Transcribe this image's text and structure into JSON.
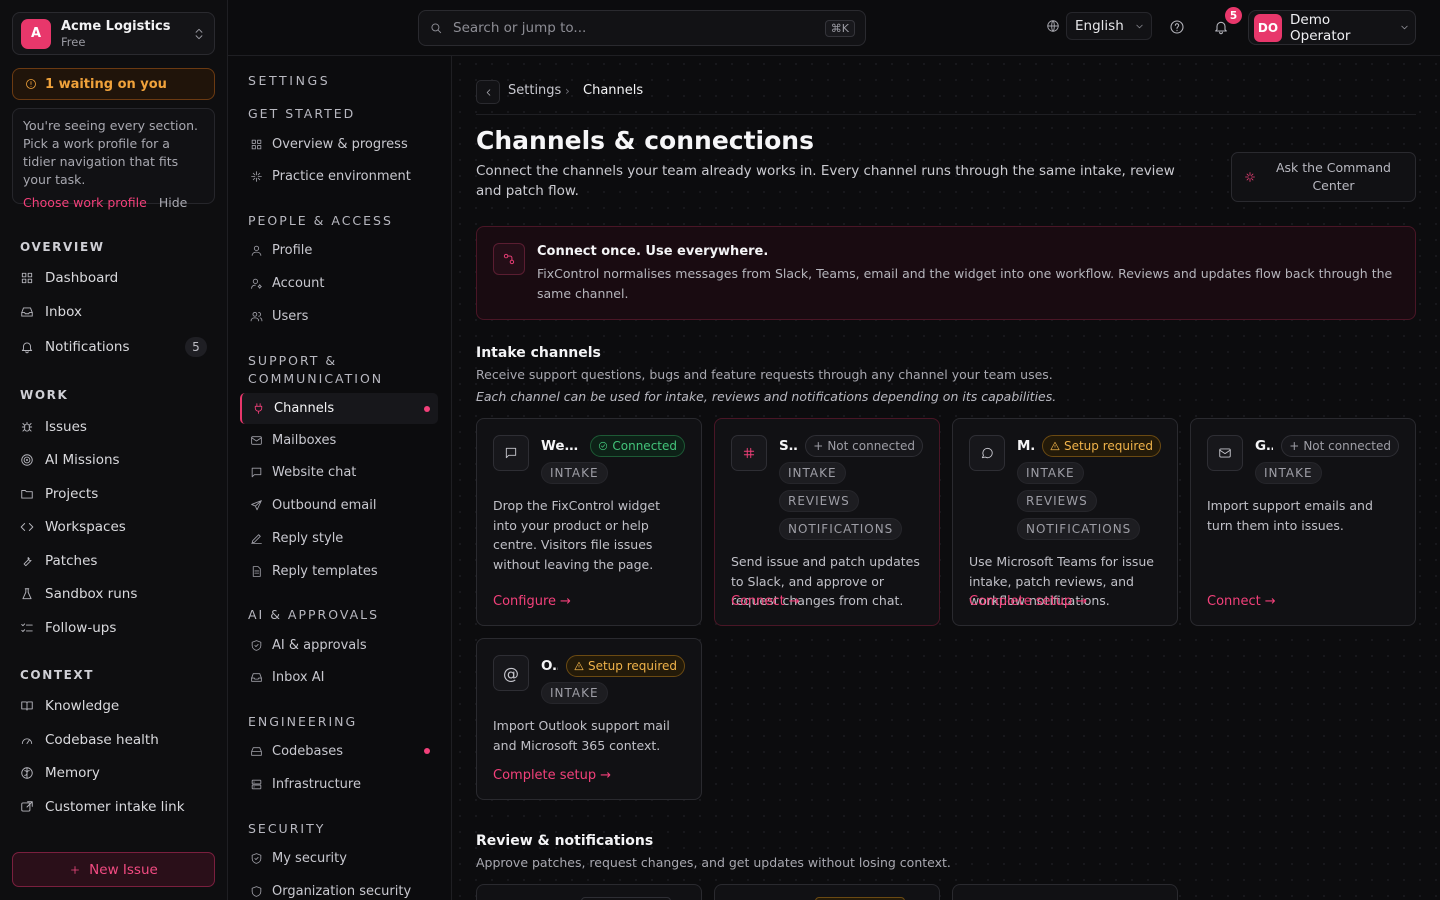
{
  "org": {
    "initial": "A",
    "name": "Acme Logistics",
    "plan": "Free"
  },
  "waiting": {
    "label": "1 waiting on you"
  },
  "profile_hint": {
    "text": "You're seeing every section. Pick a work profile for a tidier navigation that fits your task.",
    "choose_label": "Choose work profile",
    "hide_label": "Hide"
  },
  "nav": {
    "overview_title": "OVERVIEW",
    "work_title": "WORK",
    "context_title": "CONTEXT",
    "overview": [
      {
        "label": "Dashboard",
        "icon": "grid-icon"
      },
      {
        "label": "Inbox",
        "icon": "inbox-icon"
      },
      {
        "label": "Notifications",
        "icon": "bell-icon",
        "count": "5"
      }
    ],
    "work": [
      {
        "label": "Issues",
        "icon": "bug-icon"
      },
      {
        "label": "AI Missions",
        "icon": "target-icon"
      },
      {
        "label": "Projects",
        "icon": "folder-icon"
      },
      {
        "label": "Workspaces",
        "icon": "code-icon"
      },
      {
        "label": "Patches",
        "icon": "wrench-icon"
      },
      {
        "label": "Sandbox runs",
        "icon": "flask-icon"
      },
      {
        "label": "Follow-ups",
        "icon": "list-check-icon"
      }
    ],
    "context": [
      {
        "label": "Knowledge",
        "icon": "book-icon"
      },
      {
        "label": "Codebase health",
        "icon": "gauge-icon"
      },
      {
        "label": "Memory",
        "icon": "brain-icon"
      },
      {
        "label": "Customer intake link",
        "icon": "share-icon"
      }
    ],
    "new_issue_label": "New Issue"
  },
  "topbar": {
    "search_placeholder": "Search or jump to...",
    "search_shortcut": "⌘K",
    "language": "English",
    "notification_count": "5",
    "user_initials": "DO",
    "user_name": "Demo Operator"
  },
  "settings_nav": {
    "title": "SETTINGS",
    "groups": [
      {
        "title": "GET STARTED",
        "items": [
          {
            "label": "Overview & progress",
            "icon": "grid-icon"
          },
          {
            "label": "Practice environment",
            "icon": "sparkle-icon"
          }
        ]
      },
      {
        "title": "PEOPLE & ACCESS",
        "items": [
          {
            "label": "Profile",
            "icon": "user-icon"
          },
          {
            "label": "Account",
            "icon": "user-cog-icon"
          },
          {
            "label": "Users",
            "icon": "users-icon"
          }
        ]
      },
      {
        "title": "SUPPORT & COMMUNICATION",
        "items": [
          {
            "label": "Channels",
            "icon": "plug-icon"
          },
          {
            "label": "Mailboxes",
            "icon": "mail-icon"
          },
          {
            "label": "Website chat",
            "icon": "message-icon"
          },
          {
            "label": "Outbound email",
            "icon": "send-icon"
          },
          {
            "label": "Reply style",
            "icon": "pen-icon"
          },
          {
            "label": "Reply templates",
            "icon": "file-text-icon"
          }
        ]
      },
      {
        "title": "AI & APPROVALS",
        "items": [
          {
            "label": "AI & approvals",
            "icon": "shield-check-icon"
          },
          {
            "label": "Inbox AI",
            "icon": "inbox-icon"
          }
        ]
      },
      {
        "title": "ENGINEERING",
        "items": [
          {
            "label": "Codebases",
            "icon": "database-icon"
          },
          {
            "label": "Infrastructure",
            "icon": "server-icon"
          }
        ]
      },
      {
        "title": "SECURITY",
        "items": [
          {
            "label": "My security",
            "icon": "shield-check-icon"
          },
          {
            "label": "Organization security",
            "icon": "shield-icon"
          }
        ]
      }
    ]
  },
  "breadcrumb": {
    "parent": "Settings",
    "current": "Channels"
  },
  "page": {
    "title": "Channels & connections",
    "description": "Connect the channels your team already works in. Every channel runs through the same intake, review and patch flow.",
    "command_center_label": "Ask the Command Center"
  },
  "banner": {
    "title": "Connect once. Use everywhere.",
    "body": "FixControl normalises messages from Slack, Teams, email and the widget into one workflow. Reviews and updates flow back through the same channel."
  },
  "intake": {
    "title": "Intake channels",
    "subtitle": "Receive support questions, bugs and feature requests through any channel your team uses.",
    "note": "Each channel can be used for intake, reviews and notifications depending on its capabilities.",
    "cards": [
      {
        "name": "Web...",
        "icon": "message-icon",
        "status": "Connected",
        "status_type": "connected",
        "tags": [
          "INTAKE"
        ],
        "description": "Drop the FixControl widget into your product or help centre. Visitors file issues without leaving the page.",
        "action": "Configure"
      },
      {
        "name": "S...",
        "icon": "slack-icon",
        "status": "Not connected",
        "status_type": "notconn",
        "tags": [
          "INTAKE",
          "REVIEWS",
          "NOTIFICATIONS"
        ],
        "description": "Send issue and patch updates to Slack, and approve or request changes from chat.",
        "action": "Connect"
      },
      {
        "name": "M...",
        "icon": "chat-bubble-icon",
        "status": "Setup required",
        "status_type": "setup",
        "tags": [
          "INTAKE",
          "REVIEWS",
          "NOTIFICATIONS"
        ],
        "description": "Use Microsoft Teams for issue intake, patch reviews, and workflow notifications.",
        "action": "Complete setup"
      },
      {
        "name": "G...",
        "icon": "mail-icon",
        "status": "Not connected",
        "status_type": "notconn",
        "tags": [
          "INTAKE"
        ],
        "description": "Import support emails and turn them into issues.",
        "action": "Connect"
      },
      {
        "name": "O...",
        "icon": "at-icon",
        "status": "Setup required",
        "status_type": "setup",
        "tags": [
          "INTAKE"
        ],
        "description": "Import Outlook support mail and Microsoft 365 context.",
        "action": "Complete setup"
      }
    ]
  },
  "review": {
    "title": "Review & notifications",
    "subtitle": "Approve patches, request changes, and get updates without losing context."
  }
}
